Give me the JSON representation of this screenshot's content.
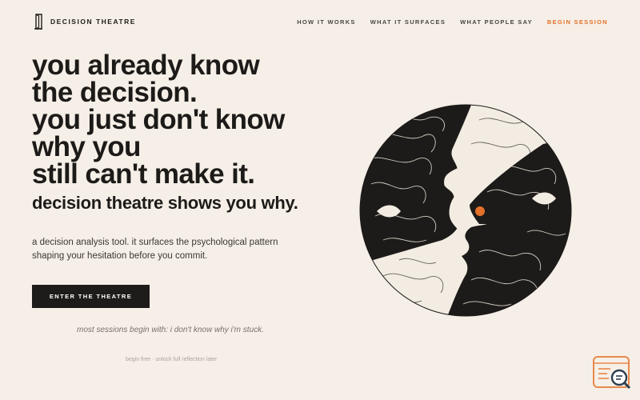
{
  "header": {
    "logo_text": "DECISION THEATRE",
    "nav": [
      {
        "label": "HOW IT WORKS"
      },
      {
        "label": "WHAT IT SURFACES"
      },
      {
        "label": "WHAT PEOPLE SAY"
      },
      {
        "label": "BEGIN SESSION"
      }
    ]
  },
  "hero": {
    "headline_lines": [
      "you already know",
      "the decision.",
      "you just don't know",
      "why you",
      "still can't make it."
    ],
    "subheadline": "decision theatre shows you why.",
    "description_line1": "a decision analysis tool. it surfaces the psychological pattern",
    "description_line2": "shaping your hesitation before you commit.",
    "cta_label": "ENTER THE THEATRE",
    "quote": "most sessions begin with: i don't know why i'm stuck.",
    "fine_print": "begin free · unlock full reflection later"
  },
  "illustration": {
    "name": "split-brain-faces-icon",
    "colors": {
      "dark": "#1d1b19",
      "light": "#f3ece2",
      "accent": "#e4702a"
    }
  },
  "widget": {
    "icon": "search-browser-icon",
    "accent": "#e8884a"
  }
}
